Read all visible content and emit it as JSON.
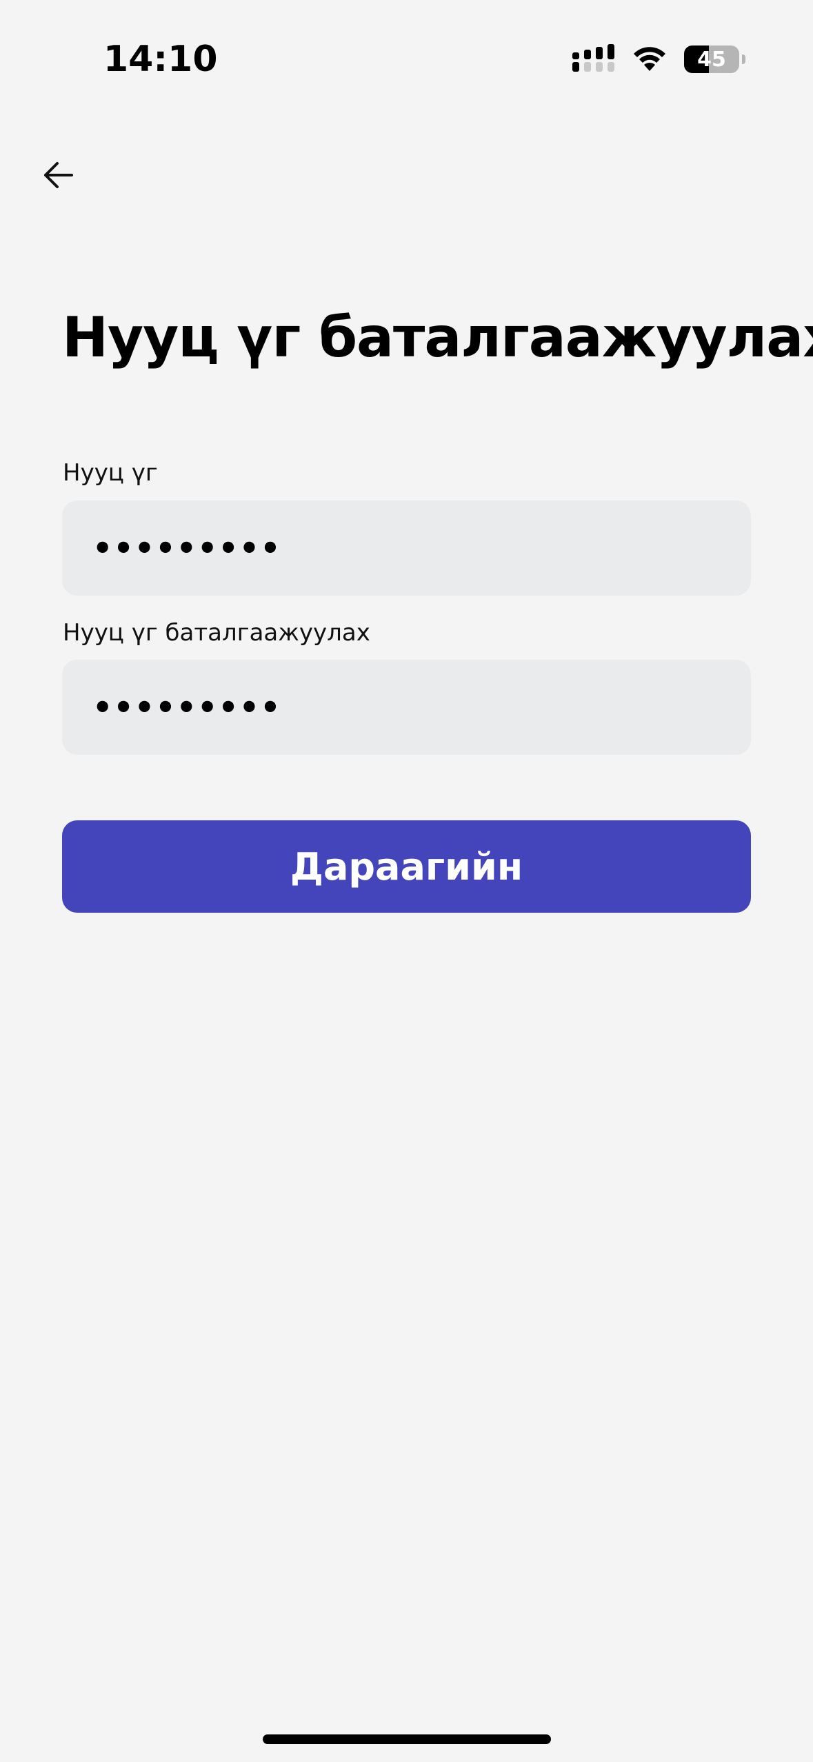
{
  "status_bar": {
    "time": "14:10",
    "battery_level": "45",
    "icons": [
      "cellular-signal-icon",
      "wifi-icon",
      "battery-icon"
    ]
  },
  "navigation": {
    "back_icon": "arrow-left-icon"
  },
  "page": {
    "title": "Нууц үг баталгаажуулах"
  },
  "form": {
    "password": {
      "label": "Нууц үг",
      "value": "•••••••••"
    },
    "confirm_password": {
      "label": "Нууц үг баталгаажуулах",
      "value": "•••••••••"
    },
    "next_button_label": "Дараагийн"
  },
  "colors": {
    "background": "#f4f4f4",
    "input_background": "#eaebed",
    "primary_button": "#4444bb",
    "primary_button_text": "#ffffff"
  }
}
